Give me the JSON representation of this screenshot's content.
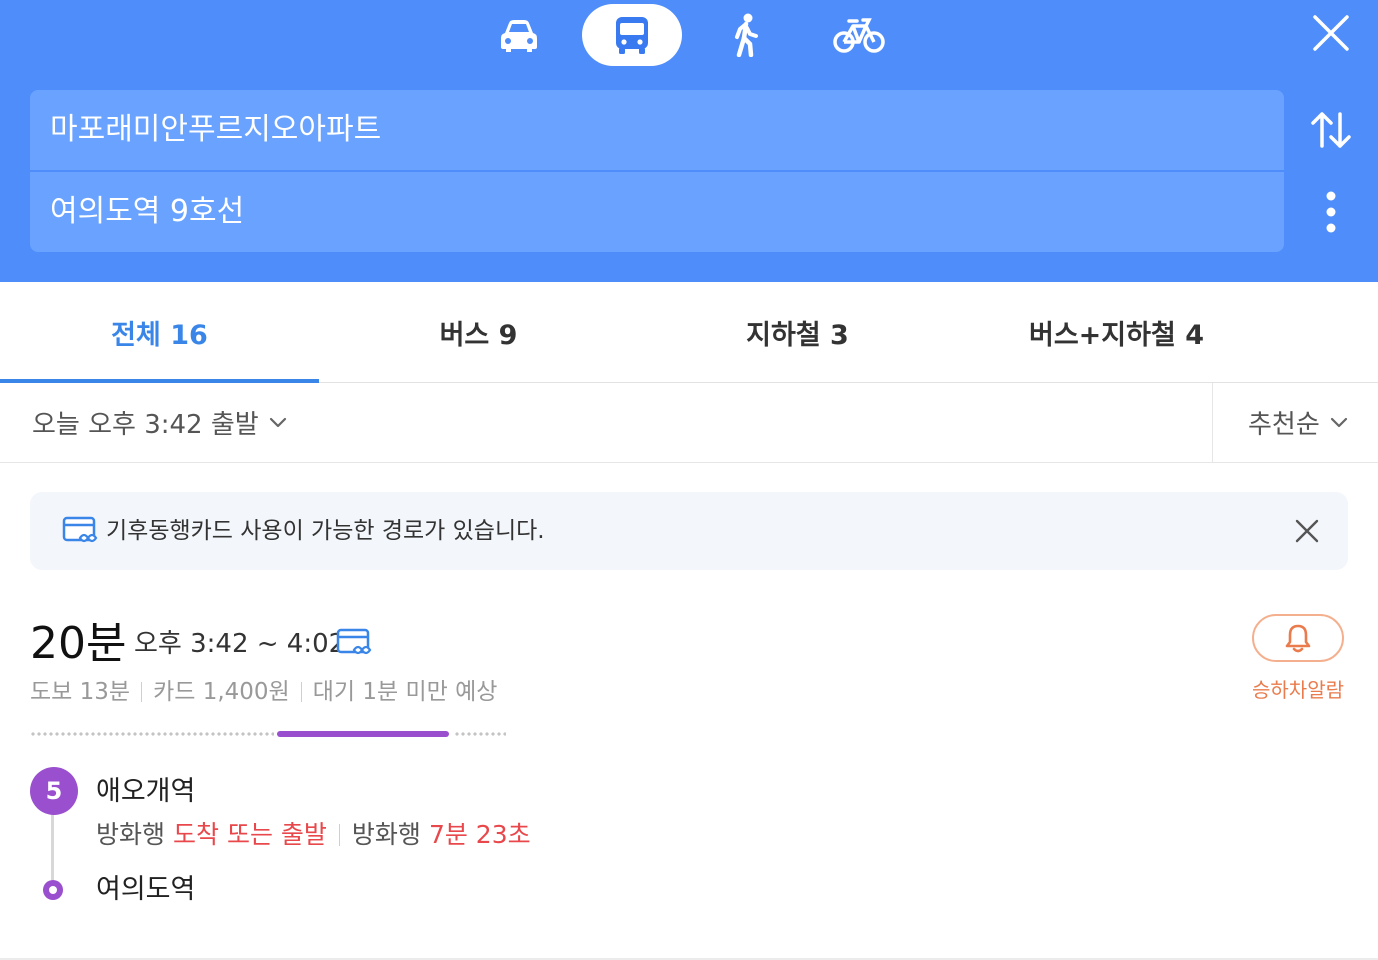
{
  "colors": {
    "header_bg": "#4f8dfb",
    "field_bg": "#6aa3ff",
    "tab_active": "#3a86e8",
    "subway_line_5": "#9a4fce",
    "alarm_orange": "#ea7b4c",
    "realtime_red": "#e8484b"
  },
  "header": {
    "modes": [
      {
        "name": "car",
        "icon": "car-icon"
      },
      {
        "name": "bus",
        "icon": "bus-icon",
        "selected": true
      },
      {
        "name": "walk",
        "icon": "walk-icon"
      },
      {
        "name": "bike",
        "icon": "bike-icon"
      }
    ],
    "close_icon": "close-icon",
    "origin": "마포래미안푸르지오아파트",
    "destination": "여의도역 9호선",
    "swap_icon": "swap-arrows-icon",
    "more_icon": "more-vertical-icon"
  },
  "tabs": [
    {
      "label": "전체 16",
      "active": true
    },
    {
      "label": "버스 9"
    },
    {
      "label": "지하철 3"
    },
    {
      "label": "버스+지하철 4"
    }
  ],
  "filter": {
    "departure": "오늘 오후 3:42 출발",
    "sort": "추천순"
  },
  "notice": {
    "icon": "climate-card-icon",
    "text": "기후동행카드 사용이 가능한 경로가 있습니다."
  },
  "route": {
    "duration": "20분",
    "time_range": "오후 3:42 ~ 4:02",
    "walk": "도보 13분",
    "fare": "카드 1,400원",
    "wait": "대기 1분 미만 예상",
    "alarm_label": "승하차알람",
    "line_badge": "5",
    "board_station": "애오개역",
    "arrivals": [
      {
        "direction": "방화행",
        "status": "도착 또는 출발"
      },
      {
        "direction": "방화행",
        "status": "7분 23초"
      }
    ],
    "alight_station": "여의도역"
  }
}
